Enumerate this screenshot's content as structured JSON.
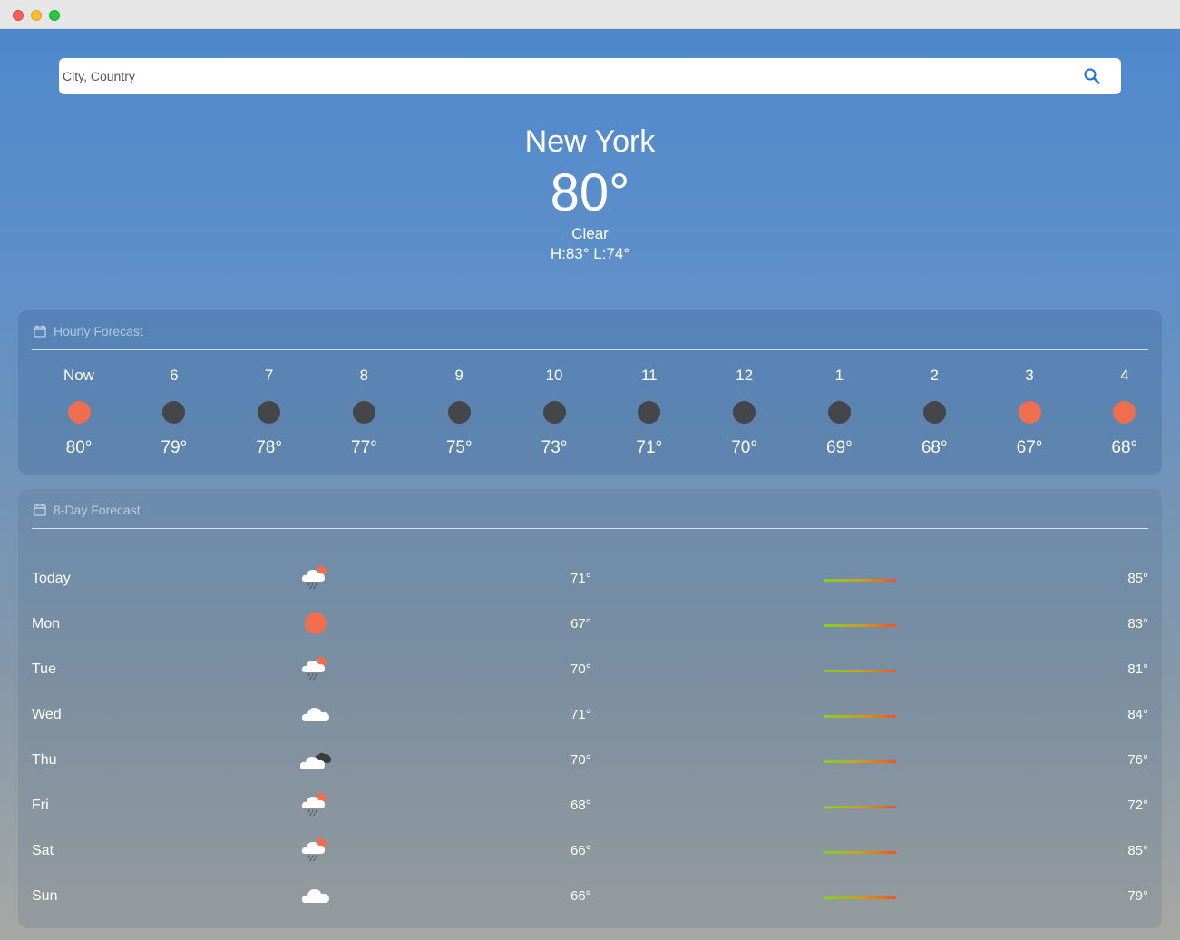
{
  "search": {
    "placeholder": "City, Country",
    "value": ""
  },
  "current": {
    "city": "New York",
    "temperature": "80°",
    "condition": "Clear",
    "high_low": "H:83° L:74°"
  },
  "hourly": {
    "title": "Hourly Forecast",
    "items": [
      {
        "label": "Now",
        "icon": "sun-icon",
        "temp": "80°"
      },
      {
        "label": "6",
        "icon": "moon-icon",
        "temp": "79°"
      },
      {
        "label": "7",
        "icon": "moon-icon",
        "temp": "78°"
      },
      {
        "label": "8",
        "icon": "moon-icon",
        "temp": "77°"
      },
      {
        "label": "9",
        "icon": "moon-icon",
        "temp": "75°"
      },
      {
        "label": "10",
        "icon": "moon-icon",
        "temp": "73°"
      },
      {
        "label": "11",
        "icon": "moon-icon",
        "temp": "71°"
      },
      {
        "label": "12",
        "icon": "moon-icon",
        "temp": "70°"
      },
      {
        "label": "1",
        "icon": "moon-icon",
        "temp": "69°"
      },
      {
        "label": "2",
        "icon": "moon-icon",
        "temp": "68°"
      },
      {
        "label": "3",
        "icon": "sun-icon",
        "temp": "67°"
      },
      {
        "label": "4",
        "icon": "sun-icon",
        "temp": "68°"
      }
    ]
  },
  "daily": {
    "title": "8-Day Forecast",
    "items": [
      {
        "day": "Today",
        "icon": "rain-sun-icon",
        "low": "71°",
        "high": "85°"
      },
      {
        "day": "Mon",
        "icon": "sun-icon",
        "low": "67°",
        "high": "83°"
      },
      {
        "day": "Tue",
        "icon": "rain-sun-icon",
        "low": "70°",
        "high": "81°"
      },
      {
        "day": "Wed",
        "icon": "cloud-icon",
        "low": "71°",
        "high": "84°"
      },
      {
        "day": "Thu",
        "icon": "dark-cloud-icon",
        "low": "70°",
        "high": "76°"
      },
      {
        "day": "Fri",
        "icon": "rain-sun-icon",
        "low": "68°",
        "high": "72°"
      },
      {
        "day": "Sat",
        "icon": "rain-sun-icon",
        "low": "66°",
        "high": "85°"
      },
      {
        "day": "Sun",
        "icon": "cloud-icon",
        "low": "66°",
        "high": "79°"
      }
    ]
  },
  "colors": {
    "sun": "#ee6e4f",
    "moon": "#454649",
    "accent": "#1e6fd9"
  }
}
